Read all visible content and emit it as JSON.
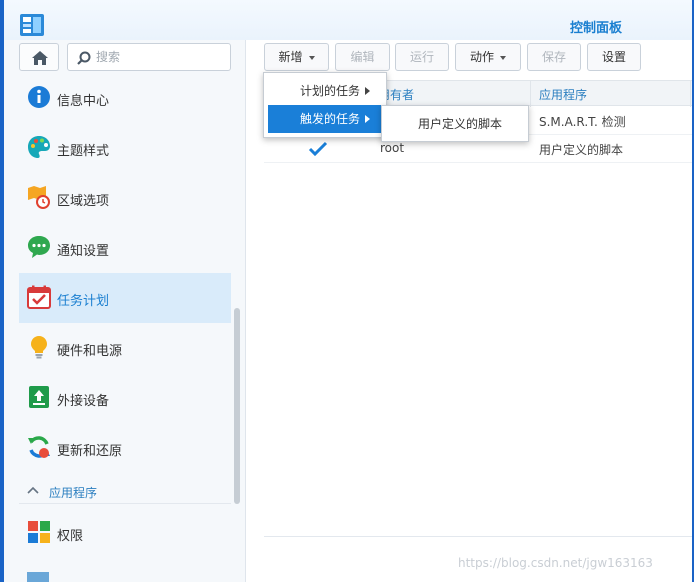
{
  "window": {
    "title": "控制面板"
  },
  "sidebar": {
    "search_placeholder": "搜索",
    "items": [
      {
        "label": "信息中心",
        "icon": "info-icon"
      },
      {
        "label": "主题样式",
        "icon": "palette-icon"
      },
      {
        "label": "区域选项",
        "icon": "region-clock-icon"
      },
      {
        "label": "通知设置",
        "icon": "chat-bubble-icon"
      },
      {
        "label": "任务计划",
        "icon": "calendar-check-icon",
        "selected": true
      },
      {
        "label": "硬件和电源",
        "icon": "lightbulb-icon"
      },
      {
        "label": "外接设备",
        "icon": "external-device-icon"
      },
      {
        "label": "更新和还原",
        "icon": "refresh-icon"
      },
      {
        "label": "权限",
        "icon": "privileges-icon"
      }
    ],
    "section_label": "应用程序"
  },
  "toolbar": {
    "create": "新增",
    "edit": "编辑",
    "run": "运行",
    "action": "动作",
    "save": "保存",
    "settings": "设置"
  },
  "grid": {
    "columns": [
      "用有者",
      "应用程序"
    ],
    "rows": [
      {
        "owner": "",
        "application": "S.M.A.R.T. 检测",
        "checked": false
      },
      {
        "owner": "root",
        "application": "用户定义的脚本",
        "checked": true
      }
    ]
  },
  "create_menu": {
    "items": [
      {
        "label": "计划的任务",
        "has_submenu": true
      },
      {
        "label": "触发的任务",
        "has_submenu": true,
        "active": true
      }
    ],
    "submenu": {
      "items": [
        "用户定义的脚本"
      ]
    }
  },
  "watermark": "https://blog.csdn.net/jgw163163",
  "colors": {
    "accent": "#1a7fd8",
    "selected_bg": "#d9ebfa",
    "border": "#1a63c6"
  }
}
